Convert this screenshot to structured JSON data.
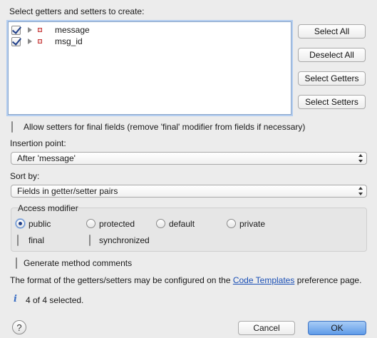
{
  "header": {
    "title": "Select getters and setters to create:"
  },
  "tree": {
    "items": [
      {
        "label": "message",
        "checked": true
      },
      {
        "label": "msg_id",
        "checked": true
      }
    ]
  },
  "buttons": {
    "select_all": "Select All",
    "deselect_all": "Deselect All",
    "select_getters": "Select Getters",
    "select_setters": "Select Setters"
  },
  "allow_setters": {
    "label": "Allow setters for final fields (remove 'final' modifier from fields if necessary)",
    "checked": false
  },
  "insertion": {
    "label": "Insertion point:",
    "value": "After 'message'"
  },
  "sort": {
    "label": "Sort by:",
    "value": "Fields in getter/setter pairs"
  },
  "access": {
    "title": "Access modifier",
    "options": [
      "public",
      "protected",
      "default",
      "private"
    ],
    "selected": "public",
    "final_label": "final",
    "final_checked": false,
    "synchronized_label": "synchronized",
    "synchronized_checked": false
  },
  "comments": {
    "label": "Generate method comments",
    "checked": false
  },
  "info": {
    "prefix": "The format of the getters/setters may be configured on the",
    "link": "Code Templates",
    "suffix": "preference page."
  },
  "status": {
    "text": "4 of 4 selected.",
    "icon": "info-icon"
  },
  "footer": {
    "help": "?",
    "cancel": "Cancel",
    "ok": "OK"
  },
  "colors": {
    "accent": "#5f9be8",
    "link": "#1a4fb5",
    "field_icon": "#c43a3a"
  }
}
